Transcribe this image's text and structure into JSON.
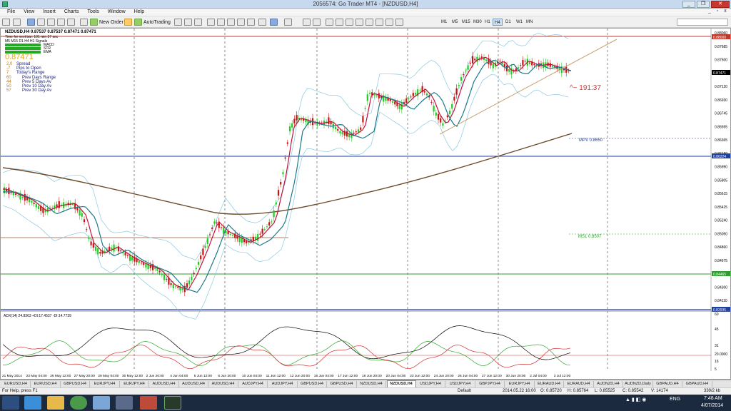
{
  "window": {
    "title": "2056574: Go Trader MT4 - [NZDUSD,H4]",
    "min": "_",
    "max": "❐",
    "close": "✕"
  },
  "menu": [
    "File",
    "View",
    "Insert",
    "Charts",
    "Tools",
    "Window",
    "Help"
  ],
  "mdi": {
    "min": "_",
    "restore": "▫",
    "close": "x"
  },
  "toolbar": {
    "new_order": "New Order",
    "auto_trading": "AutoTrading",
    "timeframes": [
      "M1",
      "M5",
      "M15",
      "M30",
      "H1",
      "H4",
      "D1",
      "W1",
      "MN"
    ],
    "active_tf": "H4"
  },
  "chart_info": {
    "header": "NZDUSD,H4  0.87537 0.87537 0.87471 0.87471",
    "timer": "Time for next bar: 191 min 37 sec",
    "tf_row": "M5 M15 D1 H4 H1 Signals",
    "ind": [
      "MACD",
      "STR",
      "EMA"
    ],
    "price": "0.87471",
    "stats": [
      {
        "value": "2.0",
        "label": "Spread"
      },
      {
        "value": "-7",
        "label": "Pips to Open"
      },
      {
        "value": "7",
        "label": "Today's Range"
      },
      {
        "value": "60",
        "label": "Prev Days Range"
      },
      {
        "value": "44",
        "label": "Prev 5 Days Av"
      },
      {
        "value": "50",
        "label": "Prev 10 Day Av"
      },
      {
        "value": "57",
        "label": "Prev 30 Day Av"
      }
    ]
  },
  "annotations": {
    "countdown": "^~ 191:37",
    "mpv": "MPV  0.8650",
    "ms1": "MS1  0.8507"
  },
  "price_axis": {
    "labels": [
      "0.88060",
      "0.87685",
      "0.87500",
      "0.87310",
      "0.87120",
      "0.86930",
      "0.86745",
      "0.86555",
      "0.86365",
      "0.86180",
      "0.85990",
      "0.85805",
      "0.85615",
      "0.85425",
      "0.85240",
      "0.85050",
      "0.84860",
      "0.84675",
      "0.84485",
      "0.84300",
      "0.84110"
    ],
    "highlights": [
      {
        "text": "0.88000",
        "color": "#c0392b"
      },
      {
        "text": "0.87471",
        "color": "#000000"
      },
      {
        "text": "0.86224",
        "color": "#1f3f9f"
      },
      {
        "text": "0.84465",
        "color": "#2e9e2e"
      },
      {
        "text": "0.83935",
        "color": "#1f3f9f"
      }
    ]
  },
  "adx": {
    "header": "ADX(14) 24.8363 +DI:17.4537 -DI:14.7739",
    "labels": [
      "60",
      "45",
      "31",
      "20.0000",
      "16",
      "5"
    ]
  },
  "time_axis": [
    "21 May 2014",
    "23 May 04:00",
    "26 May 12:00",
    "27 May 20:00",
    "29 May 04:00",
    "30 May 12:00",
    "2 Jun 20:00",
    "4 Jun 04:00",
    "5 Jun 12:00",
    "6 Jun 20:00",
    "10 Jun 04:00",
    "11 Jun 12:00",
    "12 Jun 20:00",
    "16 Jun 04:00",
    "17 Jun 12:00",
    "18 Jun 20:00",
    "20 Jun 04:00",
    "23 Jun 12:00",
    "24 Jun 20:00",
    "26 Jun 04:00",
    "27 Jun 12:00",
    "30 Jun 20:00",
    "2 Jul 04:00",
    "3 Jul 12:00"
  ],
  "tabs": [
    "EURUSD,H4",
    "EURUSD,H4",
    "GBPUSD,H4",
    "EURJPY,H4",
    "EURJPY,H4",
    "AUDUSD,H4",
    "AUDUSD,H4",
    "AUDUSD,H4",
    "AUDJPY,H4",
    "AUDJPY,H4",
    "GBPUSD,H4",
    "GBPUSD,H4",
    "NZDUSD,H4",
    "NZDUSD,H4",
    "USDJPY,H4",
    "USDJPY,H4",
    "GBPJPY,H4",
    "EURJPY,H4",
    "EURAUD,H4",
    "EURAUD,H4",
    "AUDNZD,H4",
    "AUDNZD,Daily",
    "GBPAUD,H4",
    "GBPAUD,H4"
  ],
  "active_tab": 13,
  "status": {
    "help": "For Help, press F1",
    "profile": "Default",
    "datetime": "2014.05.22 16:00",
    "open": "O: 0.85720",
    "high": "H: 0.85764",
    "low": "L: 0.85525",
    "close": "C: 0.85542",
    "volume": "V: 14174",
    "traffic": "339/2 kb"
  },
  "taskbar": {
    "lang": "ENG",
    "time": "7:48 AM",
    "date": "4/07/2014"
  }
}
